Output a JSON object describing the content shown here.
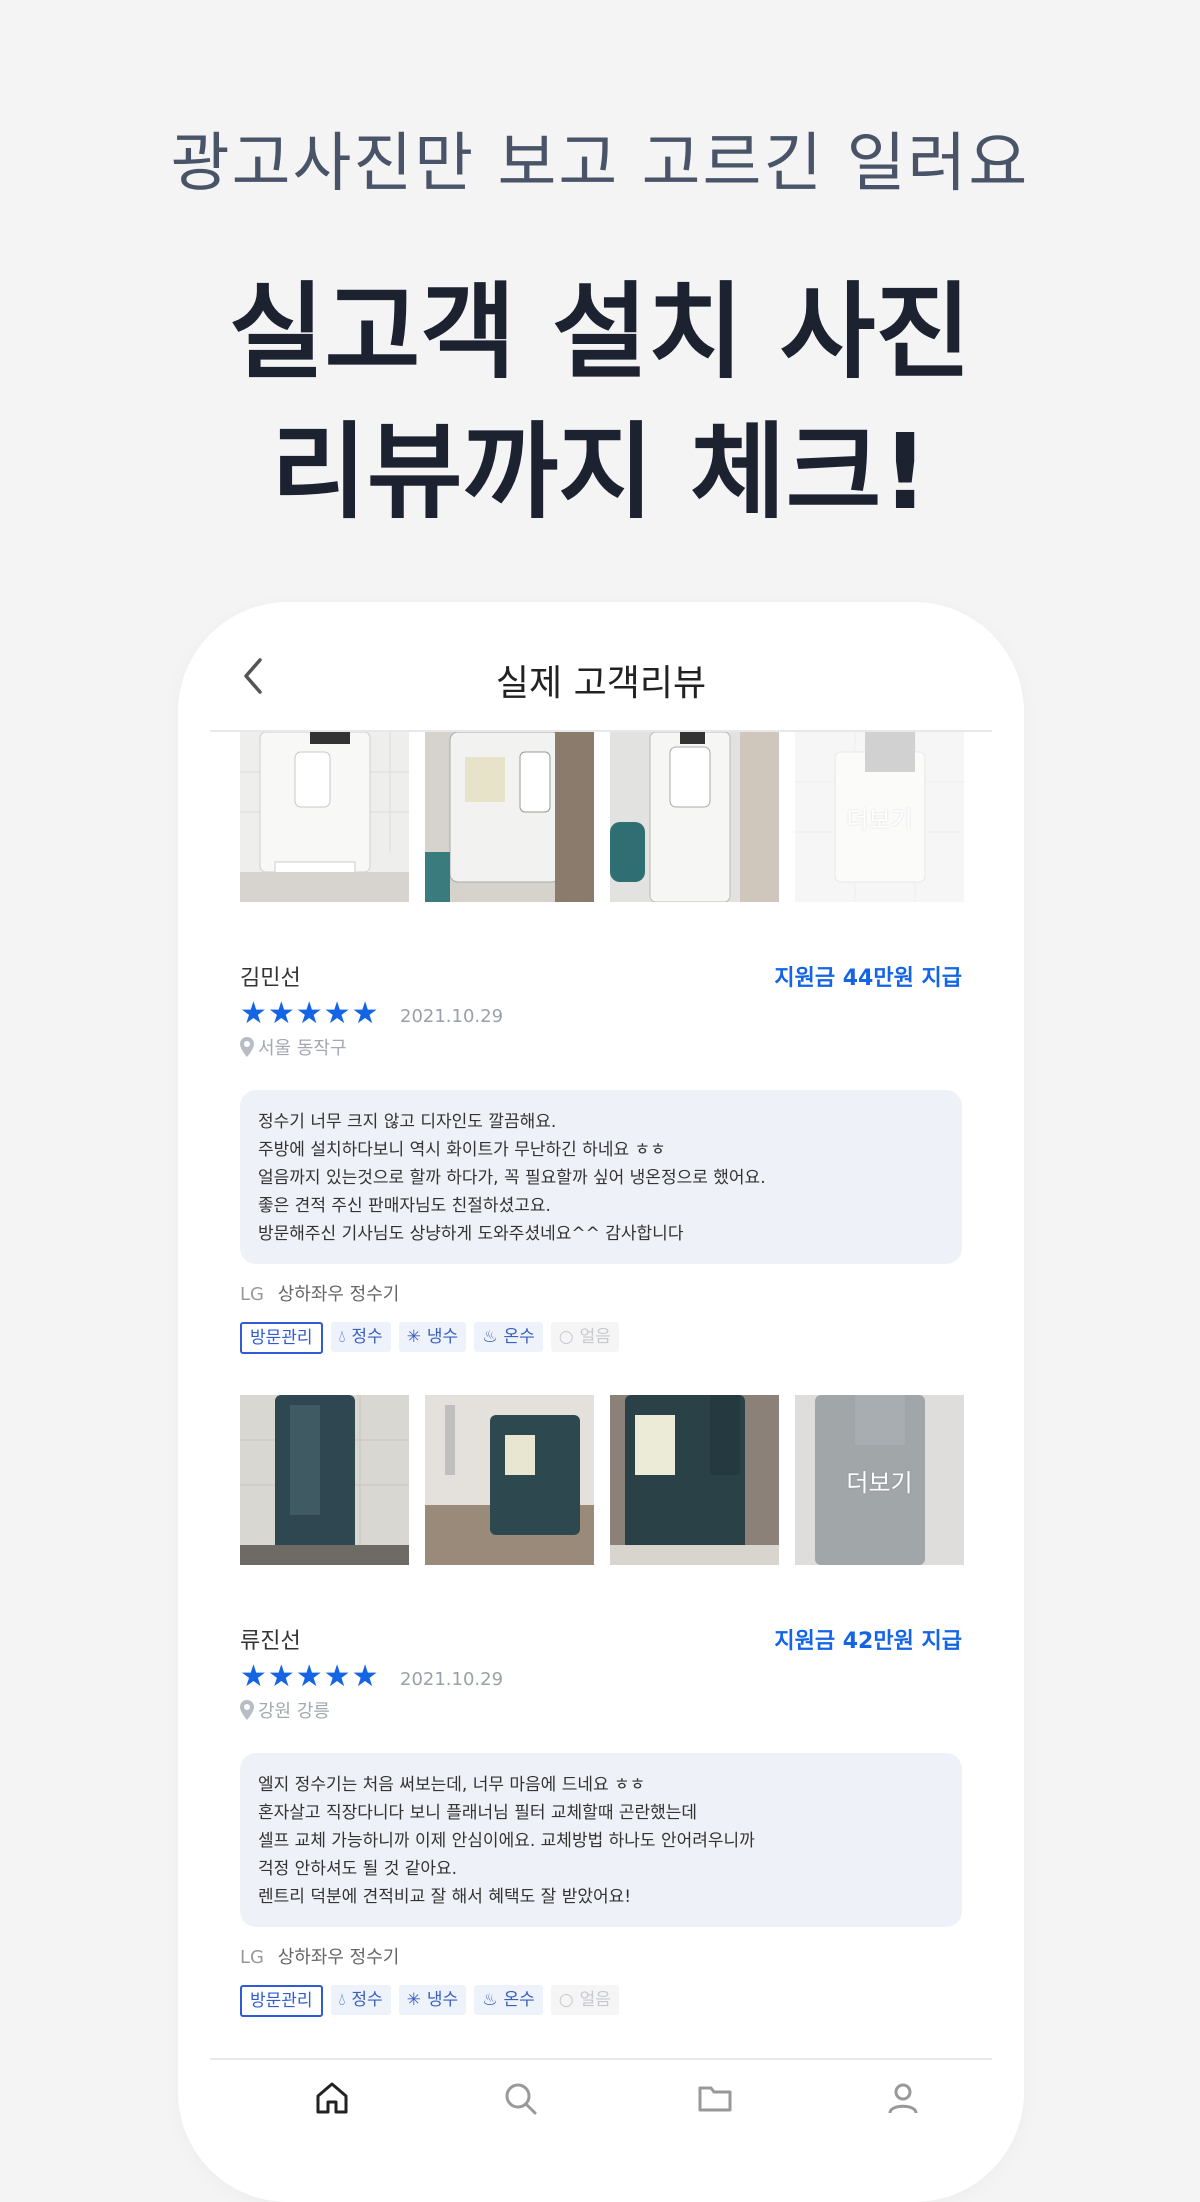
{
  "promo": {
    "subtitle": "광고사진만 보고 고르긴 일러요",
    "title_line1": "실고객 설치 사진",
    "title_line2": "리뷰까지 체크!"
  },
  "header": {
    "title": "실제 고객리뷰",
    "back_icon": "chevron-left-icon"
  },
  "reviews": [
    {
      "more_label": "더보기",
      "name": "김민선",
      "subsidy": "지원금 44만원 지급",
      "stars": "★★★★★",
      "rating": 5,
      "date": "2021.10.29",
      "location": "서울 동작구",
      "text": [
        "정수기 너무 크지 않고 디자인도 깔끔해요.",
        "주방에 설치하다보니 역시 화이트가 무난하긴 하네요 ㅎㅎ",
        "얼음까지 있는것으로 할까 하다가, 꼭 필요할까 싶어 냉온정으로 했어요.",
        "좋은 견적 주신 판매자님도 친절하셨고요.",
        "방문해주신 기사님도 상냥하게 도와주셨네요^^ 감사합니다"
      ],
      "brand": "LG",
      "product": "상하좌우 정수기",
      "tags": [
        "방문관리",
        "정수",
        "냉수",
        "온수",
        "얼음"
      ],
      "photo_color": "#ececec"
    },
    {
      "more_label": "더보기",
      "name": "류진선",
      "subsidy": "지원금 42만원 지급",
      "stars": "★★★★★",
      "rating": 5,
      "date": "2021.10.29",
      "location": "강원 강릉",
      "text": [
        "엘지 정수기는 처음 써보는데, 너무 마음에 드네요 ㅎㅎ",
        "혼자살고 직장다니다 보니 플래너님 필터 교체할때 곤란했는데",
        "셀프 교체 가능하니까 이제 안심이에요. 교체방법 하나도 안어려우니까",
        "걱정 안하셔도 될 것 같아요.",
        "렌트리 덕분에 견적비교 잘 해서 혜택도 잘 받았어요!"
      ],
      "brand": "LG",
      "product": "상하좌우 정수기",
      "tags": [
        "방문관리",
        "정수",
        "냉수",
        "온수",
        "얼음"
      ],
      "photo_color": "#2f4a52"
    }
  ],
  "colors": {
    "accent": "#1464e6",
    "bubble": "#eef1f7"
  }
}
